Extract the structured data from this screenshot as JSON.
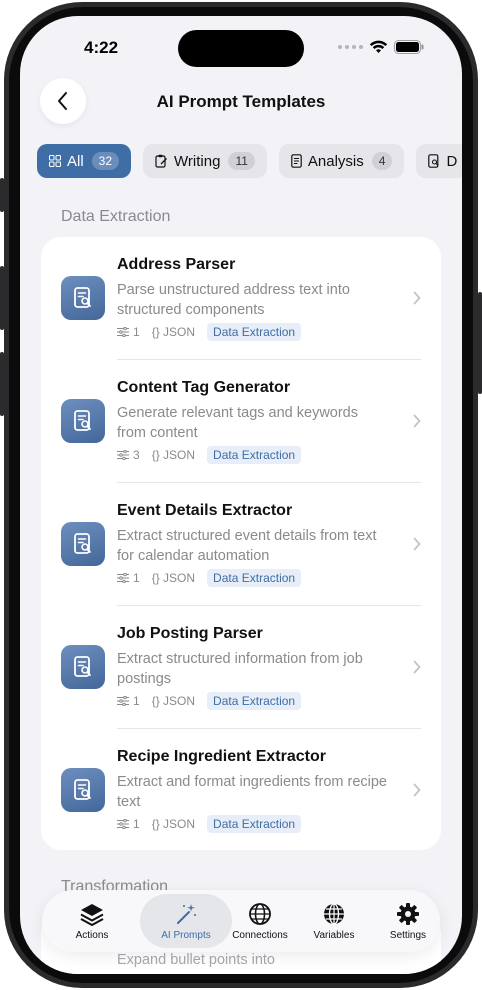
{
  "status": {
    "time": "4:22"
  },
  "header": {
    "title": "AI Prompt Templates"
  },
  "filters": [
    {
      "label": "All",
      "count": "32",
      "icon": "grid-icon",
      "active": true
    },
    {
      "label": "Writing",
      "count": "11",
      "icon": "clipboard-edit-icon",
      "active": false
    },
    {
      "label": "Analysis",
      "count": "4",
      "icon": "document-icon",
      "active": false
    },
    {
      "label": "D",
      "count": "",
      "icon": "document-search-icon",
      "active": false
    }
  ],
  "sections": [
    {
      "title": "Data Extraction",
      "items": [
        {
          "title": "Address Parser",
          "desc": "Parse unstructured address text into structured components",
          "vars": "1",
          "format": "{} JSON",
          "tag": "Data Extraction"
        },
        {
          "title": "Content Tag Generator",
          "desc": "Generate relevant tags and keywords from content",
          "vars": "3",
          "format": "{} JSON",
          "tag": "Data Extraction"
        },
        {
          "title": "Event Details Extractor",
          "desc": "Extract structured event details from text for calendar automation",
          "vars": "1",
          "format": "{} JSON",
          "tag": "Data Extraction"
        },
        {
          "title": "Job Posting Parser",
          "desc": "Extract structured information from job postings",
          "vars": "1",
          "format": "{} JSON",
          "tag": "Data Extraction"
        },
        {
          "title": "Recipe Ingredient Extractor",
          "desc": "Extract and format ingredients from recipe text",
          "vars": "1",
          "format": "{} JSON",
          "tag": "Data Extraction"
        }
      ]
    },
    {
      "title": "Transformation",
      "items": [
        {
          "desc": "Expand bullet points into"
        }
      ]
    }
  ],
  "tabbar": [
    {
      "label": "Actions",
      "icon": "stack-icon",
      "active": false
    },
    {
      "label": "AI Prompts",
      "icon": "magic-wand-icon",
      "active": true
    },
    {
      "label": "Connections",
      "icon": "globe-icon",
      "active": false
    },
    {
      "label": "Variables",
      "icon": "globe-grid-icon",
      "active": false
    },
    {
      "label": "Settings",
      "icon": "gear-icon",
      "active": false
    }
  ],
  "colors": {
    "accent": "#3f6ea6",
    "background": "#f2f2f7",
    "tag_bg": "#e7eef7"
  }
}
